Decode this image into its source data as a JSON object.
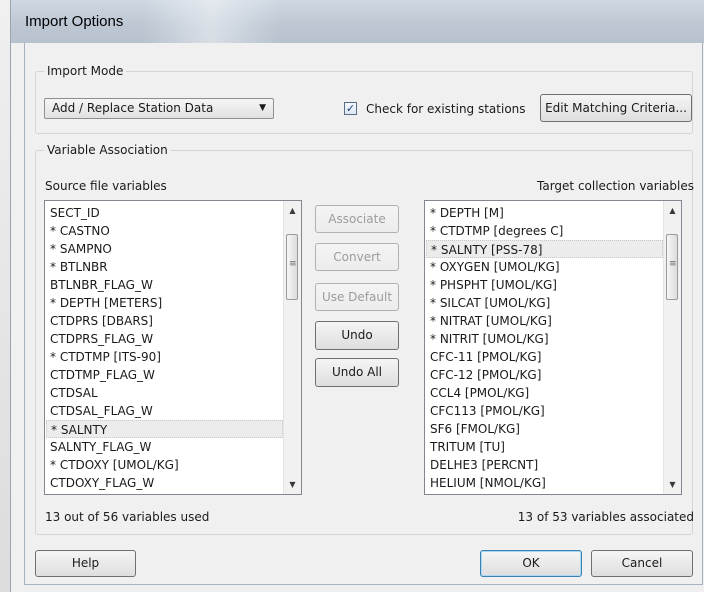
{
  "window": {
    "title": "Import Options"
  },
  "import_mode": {
    "legend": "Import Mode",
    "mode_select": {
      "selected": "Add / Replace Station Data"
    },
    "check_existing": {
      "label": "Check for existing stations",
      "checked": true
    },
    "edit_matching_label": "Edit Matching Criteria..."
  },
  "variable_association": {
    "legend": "Variable Association",
    "source_header": "Source file variables",
    "target_header": "Target collection variables",
    "source_items": [
      "SECT_ID",
      "* CASTNO",
      "* SAMPNO",
      "* BTLNBR",
      "BTLNBR_FLAG_W",
      "* DEPTH [METERS]",
      "CTDPRS [DBARS]",
      "CTDPRS_FLAG_W",
      "* CTDTMP [ITS-90]",
      "CTDTMP_FLAG_W",
      "CTDSAL",
      "CTDSAL_FLAG_W",
      "* SALNTY",
      "SALNTY_FLAG_W",
      "* CTDOXY [UMOL/KG]",
      "CTDOXY_FLAG_W"
    ],
    "source_selected_index": 12,
    "target_items": [
      "* DEPTH [M]",
      "* CTDTMP [degrees C]",
      "* SALNTY [PSS-78]",
      "* OXYGEN [UMOL/KG]",
      "* PHSPHT [UMOL/KG]",
      "* SILCAT [UMOL/KG]",
      "* NITRAT [UMOL/KG]",
      "* NITRIT [UMOL/KG]",
      "CFC-11 [PMOL/KG]",
      "CFC-12 [PMOL/KG]",
      "CCL4 [PMOL/KG]",
      "CFC113 [PMOL/KG]",
      "SF6 [FMOL/KG]",
      "TRITUM [TU]",
      "DELHE3 [PERCNT]",
      "HELIUM [NMOL/KG]"
    ],
    "target_selected_index": 2,
    "buttons": {
      "associate": "Associate",
      "convert": "Convert",
      "use_default": "Use Default",
      "undo": "Undo",
      "undo_all": "Undo All"
    },
    "source_status": "13 out of 56 variables used",
    "target_status": "13 of 53 variables associated"
  },
  "footer": {
    "help": "Help",
    "ok": "OK",
    "cancel": "Cancel"
  }
}
